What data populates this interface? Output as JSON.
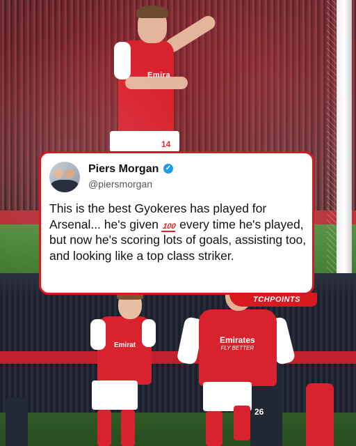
{
  "top_photo": {
    "sponsor_text": "Emira",
    "shirt_number": "14"
  },
  "tweet": {
    "author_name": "Piers Morgan",
    "handle": "@piersmorgan",
    "text_before": "This is the best Gyokeres has played for Arsenal... he's given ",
    "emoji_label": "100",
    "text_after": " every time he's played, but now he's scoring lots of goals, assisting too, and looking like a top class striker."
  },
  "source_badge": "TCHPOINTS",
  "bottom_photo": {
    "left_player_sponsor": "Emirat",
    "right_player_sponsor": "Emirates",
    "right_player_sponsor_sub": "FLY BETTER",
    "opponent_number": "26"
  },
  "colors": {
    "accent_red": "#d71920",
    "verified_blue": "#1d9bf0"
  }
}
